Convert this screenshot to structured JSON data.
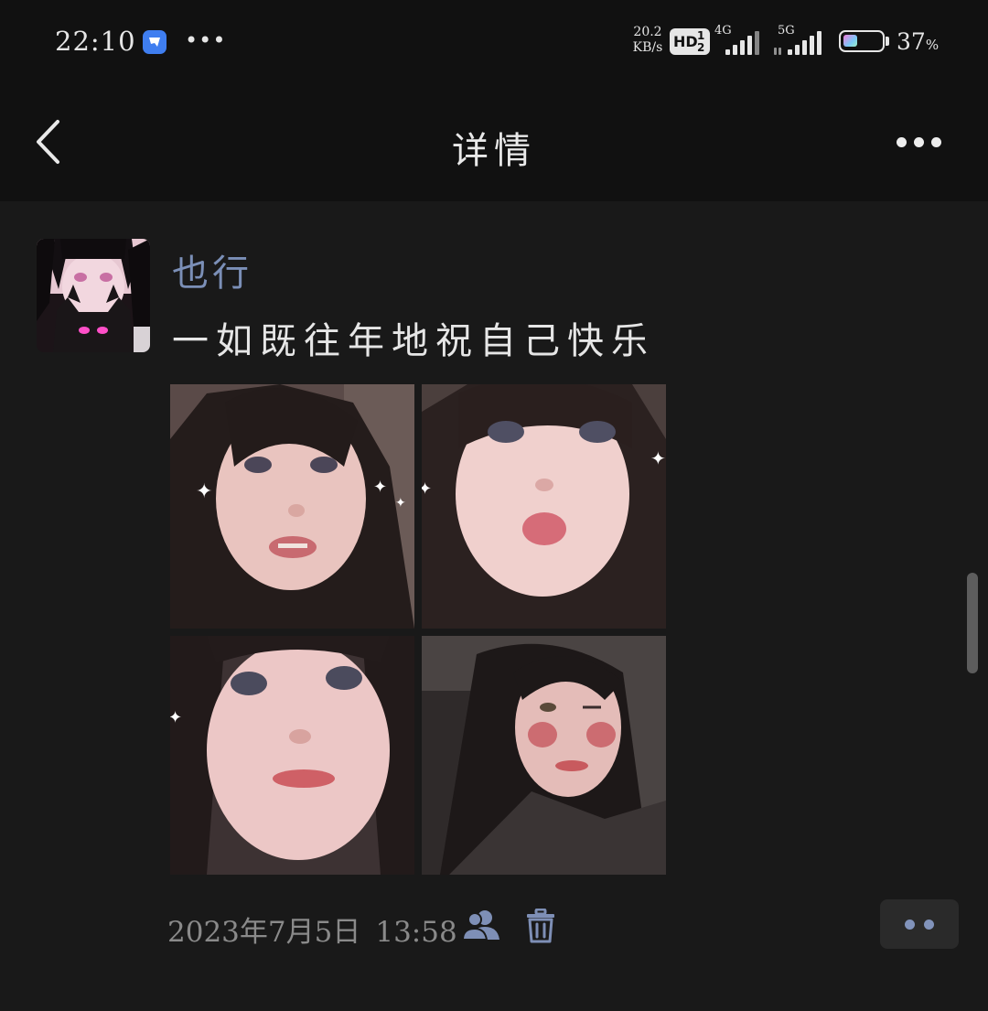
{
  "status_bar": {
    "time": "22:10",
    "more_notifications": "•••",
    "net_speed_value": "20.2",
    "net_speed_unit": "KB/s",
    "hd_label": "HD",
    "hd_sup": "1",
    "hd_sub": "2",
    "network_1": "4G",
    "network_2": "5G",
    "battery_percent": "37",
    "battery_percent_sign": "%",
    "battery_level": 0.37
  },
  "header": {
    "title": "详情"
  },
  "post": {
    "username": "也行",
    "text": "一如既往年地祝自己快乐",
    "photos": [
      {
        "name": "selfie-1"
      },
      {
        "name": "selfie-2"
      },
      {
        "name": "selfie-3"
      },
      {
        "name": "selfie-4"
      }
    ],
    "date": "2023年7月5日",
    "time": "13:58"
  },
  "colors": {
    "background": "#191919",
    "header": "#111111",
    "username": "#7b8fb7",
    "text": "#e6e6e6",
    "meta": "#8a8a8a",
    "icon_accent": "#8193bb"
  }
}
